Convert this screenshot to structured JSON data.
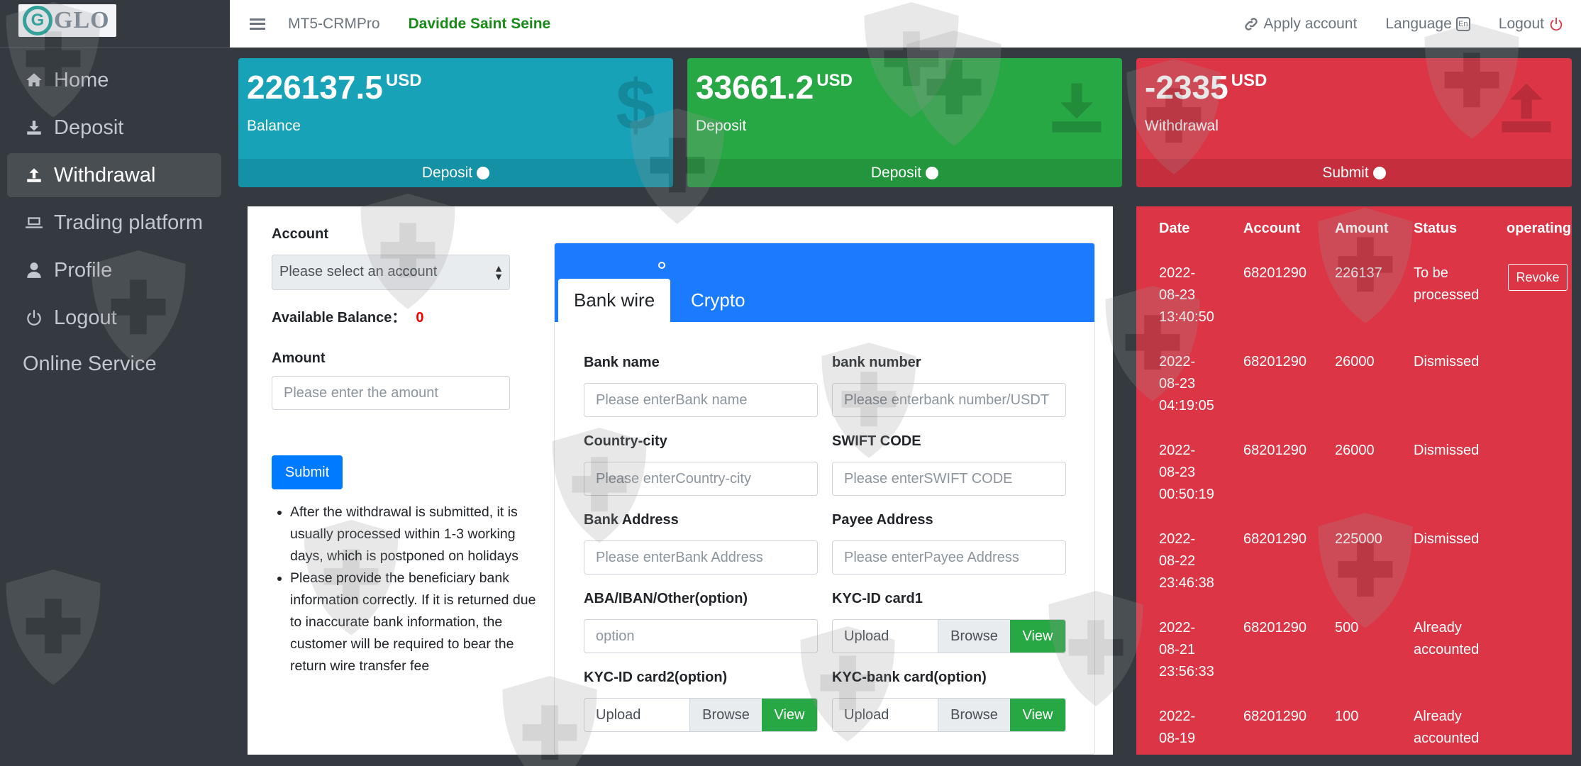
{
  "logo": {
    "letter": "G",
    "text": "GLO"
  },
  "sidebar": {
    "items": [
      {
        "label": "Home",
        "icon": "home-icon"
      },
      {
        "label": "Deposit",
        "icon": "download-icon"
      },
      {
        "label": "Withdrawal",
        "icon": "upload-icon"
      },
      {
        "label": "Trading platform",
        "icon": "laptop-icon"
      },
      {
        "label": "Profile",
        "icon": "user-icon"
      },
      {
        "label": "Logout",
        "icon": "power-icon"
      }
    ],
    "online_service": "Online Service"
  },
  "topbar": {
    "brand": "MT5-CRMPro",
    "user": "Davidde Saint Seine",
    "apply_account": "Apply account",
    "language": "Language",
    "language_badge": "En",
    "logout": "Logout"
  },
  "cards": {
    "balance": {
      "value": "226137.5",
      "unit": "USD",
      "label": "Balance",
      "footer": "Deposit",
      "color": "#17a2b8"
    },
    "deposit": {
      "value": "33661.2",
      "unit": "USD",
      "label": "Deposit",
      "footer": "Deposit",
      "color": "#28a745"
    },
    "withdrawal": {
      "value": "-2335",
      "unit": "USD",
      "label": "Withdrawal",
      "footer": "Submit",
      "color": "#dc3545"
    }
  },
  "form": {
    "account_label": "Account",
    "account_select": "Please select an account",
    "available_label": "Available Balance：",
    "available_value": "0",
    "amount_label": "Amount",
    "amount_placeholder": "Please enter the amount",
    "submit": "Submit",
    "notes": [
      "After the withdrawal is submitted, it is usually processed within 1-3 working days, which is postponed on holidays",
      "Please provide the beneficiary bank information correctly. If it is returned due to inaccurate bank information, the customer will be required to bear the return wire transfer fee"
    ]
  },
  "tabs": {
    "bank_wire": "Bank wire",
    "crypto": "Crypto"
  },
  "bank_form": {
    "bank_name_label": "Bank name",
    "bank_name_ph": "Please enterBank name",
    "bank_number_label": "bank number",
    "bank_number_ph": "Please enterbank number/USDT",
    "country_label": "Country-city",
    "country_ph": "Please enterCountry-city",
    "swift_label": "SWIFT CODE",
    "swift_ph": "Please enterSWIFT CODE",
    "bank_address_label": "Bank Address",
    "bank_address_ph": "Please enterBank Address",
    "payee_address_label": "Payee Address",
    "payee_address_ph": "Please enterPayee Address",
    "aba_label": "ABA/IBAN/Other(option)",
    "aba_ph": "option",
    "kyc1_label": "KYC-ID card1",
    "kyc2_label": "KYC-ID card2(option)",
    "kyc_bank_label": "KYC-bank card(option)",
    "upload": "Upload",
    "browse": "Browse",
    "view": "View"
  },
  "history": {
    "headers": [
      "Date",
      "Account",
      "Amount",
      "Status",
      "operating"
    ],
    "revoke": "Revoke",
    "rows": [
      {
        "date": [
          "2022-",
          "08-23",
          "13:40:50"
        ],
        "account": "68201290",
        "amount": "226137",
        "status": [
          "To be",
          "processed"
        ]
      },
      {
        "date": [
          "2022-",
          "08-23",
          "04:19:05"
        ],
        "account": "68201290",
        "amount": "26000",
        "status": [
          "Dismissed"
        ]
      },
      {
        "date": [
          "2022-",
          "08-23",
          "00:50:19"
        ],
        "account": "68201290",
        "amount": "26000",
        "status": [
          "Dismissed"
        ]
      },
      {
        "date": [
          "2022-",
          "08-22",
          "23:46:38"
        ],
        "account": "68201290",
        "amount": "225000",
        "status": [
          "Dismissed"
        ]
      },
      {
        "date": [
          "2022-",
          "08-21",
          "23:56:33"
        ],
        "account": "68201290",
        "amount": "500",
        "status": [
          "Already",
          "accounted"
        ]
      },
      {
        "date": [
          "2022-",
          "08-19"
        ],
        "account": "68201290",
        "amount": "100",
        "status": [
          "Already",
          "accounted"
        ]
      }
    ]
  }
}
